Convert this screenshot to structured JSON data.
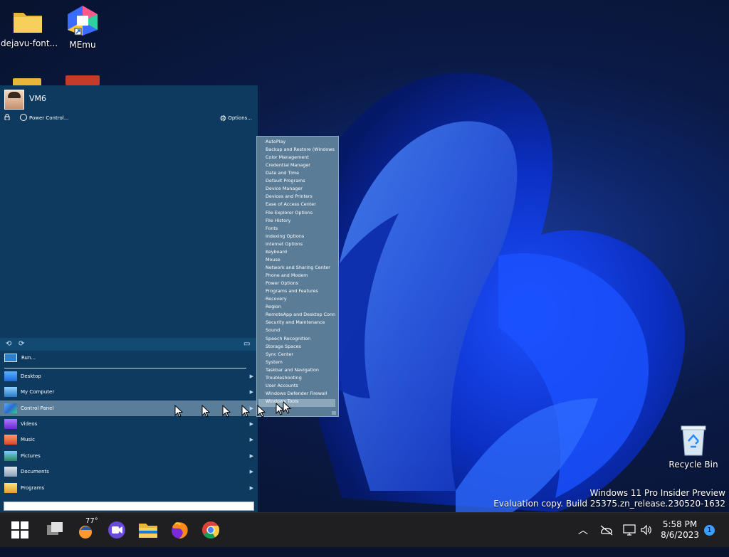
{
  "desktop": {
    "icons": [
      {
        "label": "dejavu-font...",
        "icon": "folder-icon"
      },
      {
        "label": "MEmu",
        "icon": "memu-icon"
      },
      {
        "label": "Recycle Bin",
        "icon": "recycle-bin-icon"
      }
    ],
    "watermark": {
      "line1": "Windows 11 Pro Insider Preview",
      "line2": "Evaluation copy. Build 25375.zn_release.230520-1632"
    }
  },
  "start_menu": {
    "user_name": "VM6",
    "power_label": "Power Control...",
    "options_label": "Options...",
    "run_label": "Run...",
    "items": [
      {
        "label": "Desktop",
        "icon": "desktop-icon",
        "arrow": "▶"
      },
      {
        "label": "My Computer",
        "icon": "computer-icon",
        "arrow": "▶"
      },
      {
        "label": "Control Panel",
        "icon": "control-panel-icon",
        "arrow": "▶",
        "selected": true
      },
      {
        "label": "Videos",
        "icon": "videos-icon",
        "arrow": "▶"
      },
      {
        "label": "Music",
        "icon": "music-icon",
        "arrow": "▶"
      },
      {
        "label": "Pictures",
        "icon": "pictures-icon",
        "arrow": "▶"
      },
      {
        "label": "Documents",
        "icon": "documents-icon",
        "arrow": "▶"
      },
      {
        "label": "Programs",
        "icon": "programs-icon",
        "arrow": "▶"
      }
    ]
  },
  "control_panel_submenu": {
    "items": [
      "AutoPlay",
      "Backup and Restore (Windows",
      "Color Management",
      "Credential Manager",
      "Date and Time",
      "Default Programs",
      "Device Manager",
      "Devices and Printers",
      "Ease of Access Center",
      "File Explorer Options",
      "File History",
      "Fonts",
      "Indexing Options",
      "Internet Options",
      "Keyboard",
      "Mouse",
      "Network and Sharing Center",
      "Phone and Modem",
      "Power Options",
      "Programs and Features",
      "Recovery",
      "Region",
      "RemoteApp and Desktop Conn",
      "Security and Maintenance",
      "Sound",
      "Speech Recognition",
      "Storage Spaces",
      "Sync Center",
      "System",
      "Taskbar and Navigation",
      "Troubleshooting",
      "User Accounts",
      "Windows Defender Firewall",
      "Windows Tools"
    ],
    "highlighted": "Windows Tools"
  },
  "taskbar": {
    "weather_temp": "77°",
    "time": "5:58 PM",
    "date": "8/6/2023",
    "notification_count": "1"
  },
  "colors": {
    "start_bg": "#0d3a5e",
    "submenu_bg": "#5a7c96",
    "taskbar_bg": "#1f1f22",
    "accent": "#3aa0ff"
  }
}
